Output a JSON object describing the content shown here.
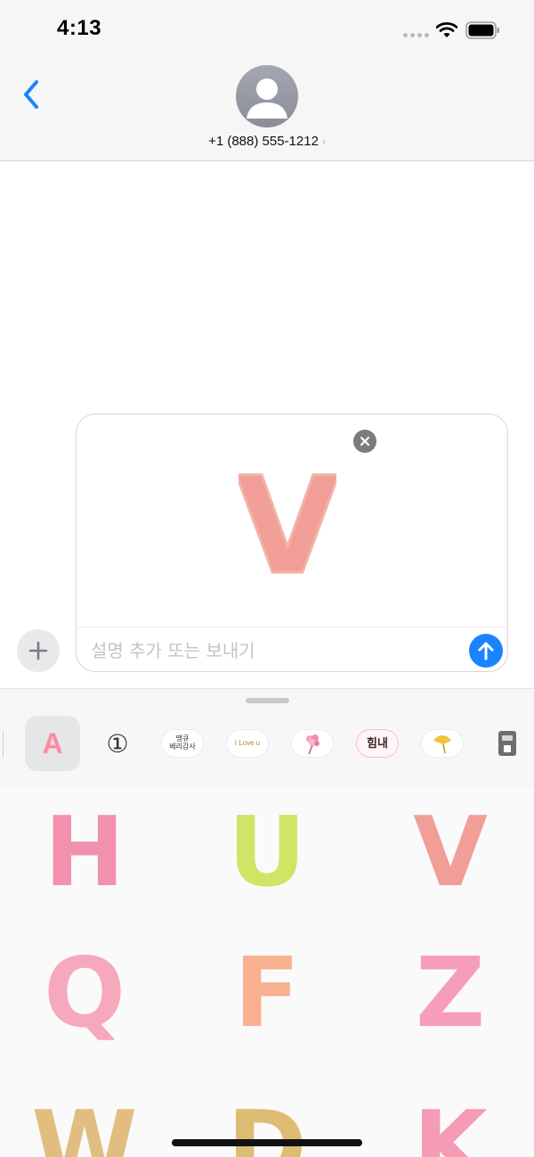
{
  "status_bar": {
    "time": "4:13",
    "icons": [
      "signal-dots-icon",
      "wifi-icon",
      "battery-icon"
    ]
  },
  "header": {
    "back_icon": "chevron-left-icon",
    "avatar_icon": "person-silhouette-icon",
    "contact": "+1 (888) 555-1212",
    "contact_chevron": "›"
  },
  "compose": {
    "sticker": {
      "letter": "V",
      "color": "#ef8c86"
    },
    "remove_icon": "close-circle-icon",
    "caption_placeholder": "설명 추가 또는 보내기",
    "caption_value": "",
    "send_icon": "arrow-up-icon",
    "add_icon": "plus-icon"
  },
  "drawer": {
    "app_strip": [
      {
        "name": "alphabet-sticker-app",
        "glyph": "A",
        "selected": true
      },
      {
        "name": "number-sticker-app",
        "glyph": "①",
        "selected": false
      },
      {
        "name": "korean-message-sticker-app",
        "glyph": "땡큐\n베리감사",
        "selected": false
      },
      {
        "name": "i-love-you-sticker-app",
        "glyph": "I Love u",
        "selected": false
      },
      {
        "name": "flower-bouquet-sticker-app",
        "glyph": "",
        "selected": false
      },
      {
        "name": "hearts-message-sticker-app",
        "glyph": "힘내",
        "selected": false
      },
      {
        "name": "ginkgo-leaf-sticker-app",
        "glyph": "",
        "selected": false
      },
      {
        "name": "coffee-machine-sticker-app",
        "glyph": "",
        "selected": false
      }
    ],
    "stickers": [
      {
        "letter": "H",
        "color": "#f07ea0"
      },
      {
        "letter": "U",
        "color": "#c5e04a"
      },
      {
        "letter": "V",
        "color": "#ef8c86"
      },
      {
        "letter": "Q",
        "color": "#f59ab0"
      },
      {
        "letter": "F",
        "color": "#f7a27c"
      },
      {
        "letter": "Z",
        "color": "#f58cae"
      },
      {
        "letter": "W",
        "color": "#dcb36a"
      },
      {
        "letter": "D",
        "color": "#d9b05c"
      },
      {
        "letter": "K",
        "color": "#f28aa8"
      }
    ]
  },
  "colors": {
    "accent": "#1a84ff",
    "header_bg": "#f6f6f6",
    "drawer_bg": "#f7f7f7"
  }
}
